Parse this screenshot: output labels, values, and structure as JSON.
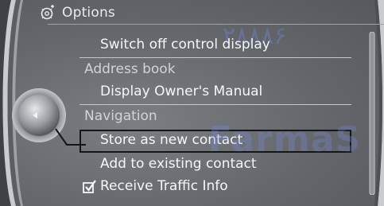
{
  "header": {
    "icon": "settings-options-icon",
    "title": "Options"
  },
  "menu": {
    "items": [
      {
        "label": "Switch off control display",
        "type": "action"
      },
      {
        "label": "Address book",
        "type": "section"
      },
      {
        "label": "Display Owner's Manual",
        "type": "action"
      },
      {
        "label": "Navigation",
        "type": "section"
      },
      {
        "label": "Store as new contact",
        "type": "action",
        "selected": true
      },
      {
        "label": "Add to existing contact",
        "type": "action"
      },
      {
        "label": "Receive Traffic Info",
        "type": "checkbox",
        "checked": true
      }
    ]
  },
  "watermark": {
    "digits": "۲۸۸۸۶",
    "brand": "FarmaS"
  },
  "colors": {
    "background": "#63666a",
    "text": "#f5f7f8",
    "section_text": "#d0d4d8",
    "separator": "#c6c9cc",
    "selection_border": "#161616"
  }
}
